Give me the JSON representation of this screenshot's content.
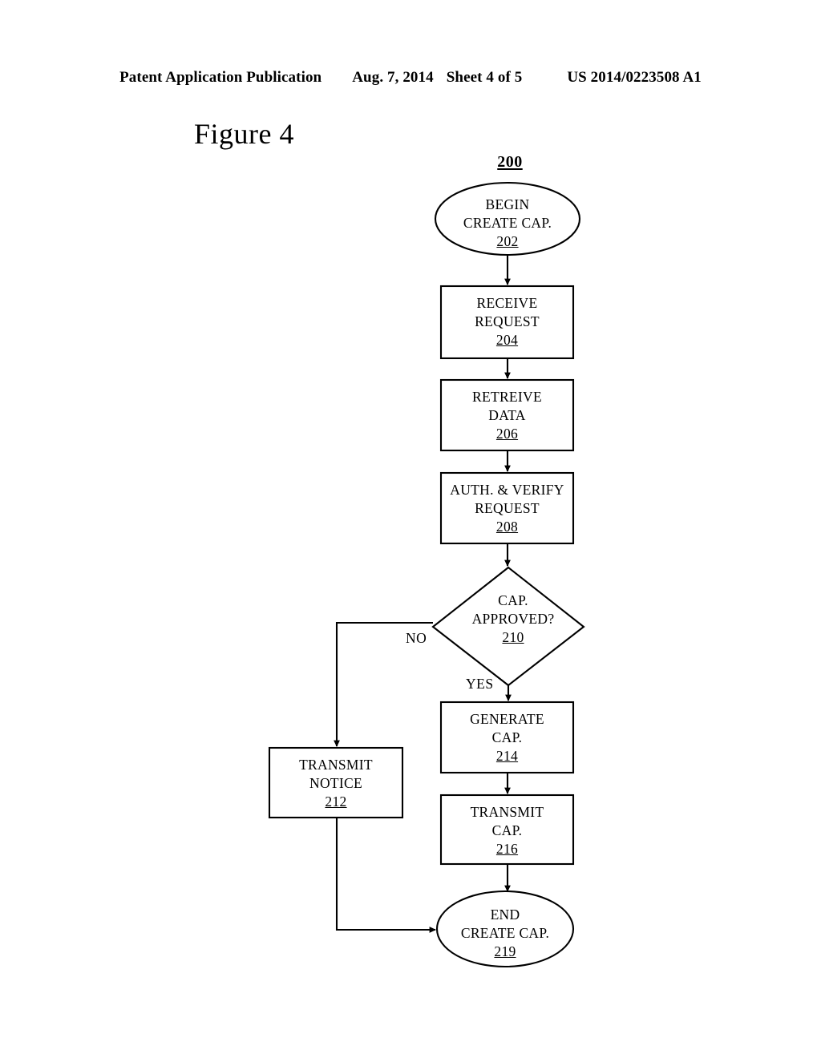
{
  "header": {
    "publication": "Patent Application Publication",
    "date": "Aug. 7, 2014",
    "sheet": "Sheet 4 of 5",
    "document_number": "US 2014/0223508 A1"
  },
  "figure": {
    "title": "Figure 4",
    "diagram_reference": "200"
  },
  "flowchart": {
    "nodes": {
      "begin": {
        "shape": "ellipse",
        "line1": "BEGIN",
        "line2": "CREATE CAP.",
        "ref": "202"
      },
      "receive_request": {
        "shape": "process",
        "line1": "RECEIVE",
        "line2": "REQUEST",
        "ref": "204"
      },
      "retrieve_data": {
        "shape": "process",
        "line1": "RETREIVE",
        "line2": "DATA",
        "ref": "206"
      },
      "auth_verify": {
        "shape": "process",
        "line1": "AUTH. & VERIFY",
        "line2": "REQUEST",
        "ref": "208"
      },
      "cap_approved": {
        "shape": "decision",
        "line1": "CAP.",
        "line2": "APPROVED?",
        "ref": "210"
      },
      "transmit_notice": {
        "shape": "process",
        "line1": "TRANSMIT",
        "line2": "NOTICE",
        "ref": "212"
      },
      "generate_cap": {
        "shape": "process",
        "line1": "GENERATE",
        "line2": "CAP.",
        "ref": "214"
      },
      "transmit_cap": {
        "shape": "process",
        "line1": "TRANSMIT",
        "line2": "CAP.",
        "ref": "216"
      },
      "end": {
        "shape": "ellipse",
        "line1": "END",
        "line2": "CREATE CAP.",
        "ref": "219"
      }
    },
    "branch_labels": {
      "no": "NO",
      "yes": "YES"
    }
  },
  "colors": {
    "ink": "#000000",
    "paper": "#ffffff"
  }
}
